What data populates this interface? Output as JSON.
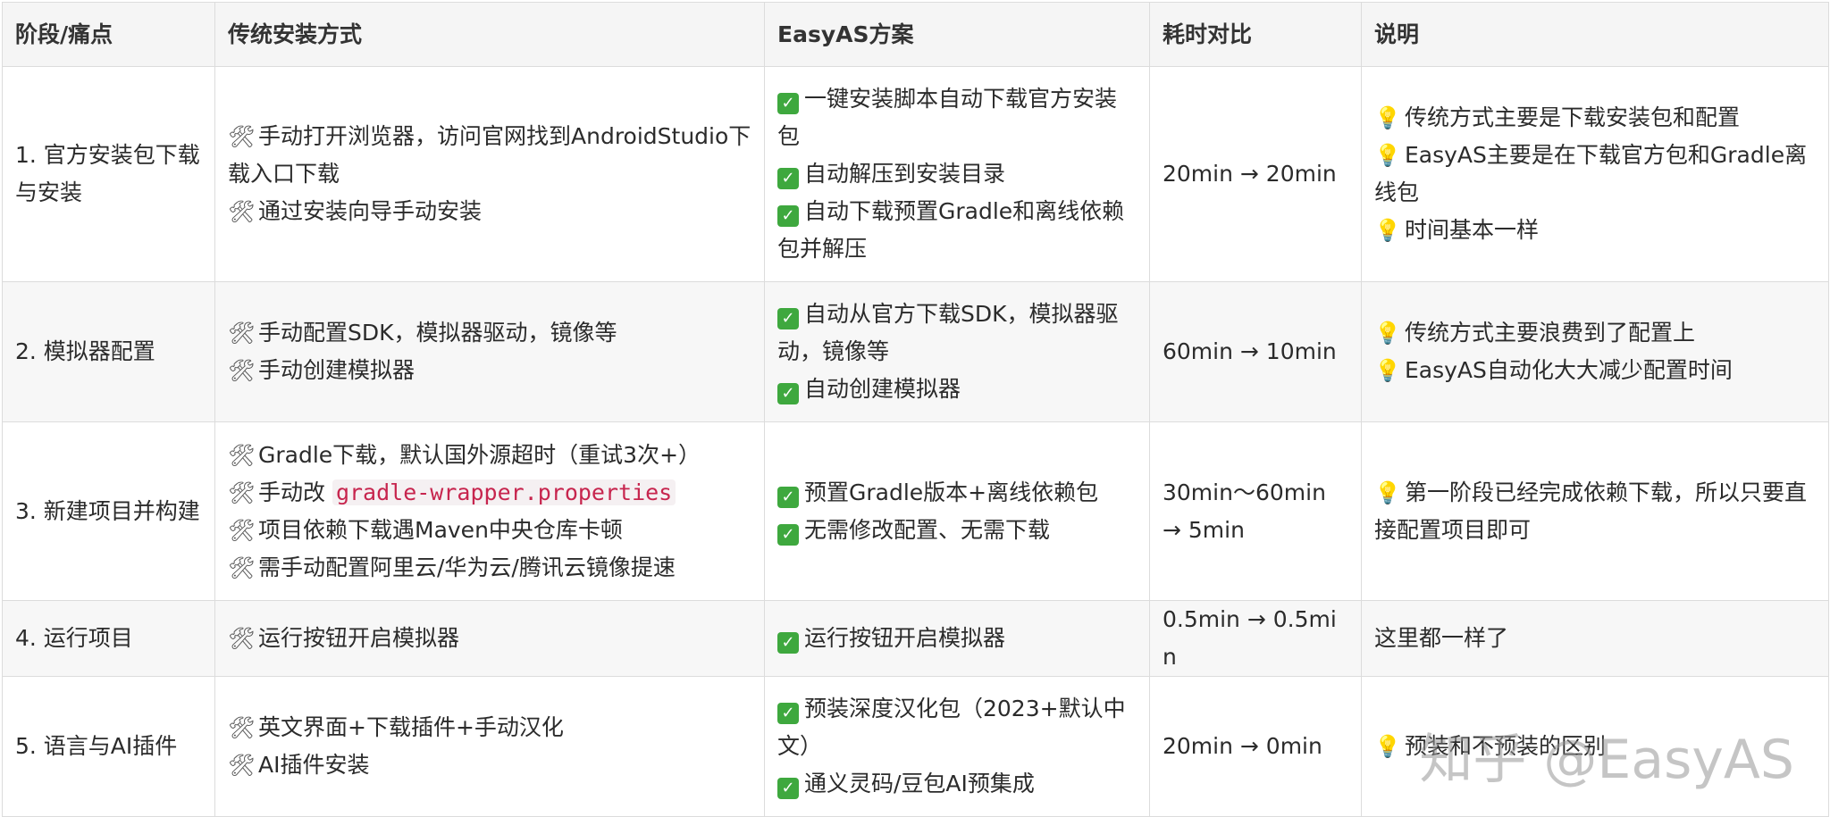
{
  "table": {
    "headers": [
      "阶段/痛点",
      "传统安装方式",
      "EasyAS方案",
      "耗时对比",
      "说明"
    ],
    "rows": [
      {
        "stage": "1. 官方安装包下载与安装",
        "traditional": [
          {
            "text": "手动打开浏览器，访问官网找到AndroidStudio下载入口下载"
          },
          {
            "text": "通过安装向导手动安装"
          }
        ],
        "easyas": [
          {
            "text": "一键安装脚本自动下载官方安装包"
          },
          {
            "text": "自动解压到安装目录"
          },
          {
            "text": "自动下载预置Gradle和离线依赖包并解压"
          }
        ],
        "time": "20min → 20min",
        "notes": [
          {
            "text": "传统方式主要是下载安装包和配置"
          },
          {
            "text": "EasyAS主要是在下载官方包和Gradle离线包"
          },
          {
            "text": "时间基本一样"
          }
        ]
      },
      {
        "stage": "2. 模拟器配置",
        "traditional": [
          {
            "text": "手动配置SDK，模拟器驱动，镜像等"
          },
          {
            "text": "手动创建模拟器"
          }
        ],
        "easyas": [
          {
            "text": "自动从官方下载SDK，模拟器驱动，镜像等"
          },
          {
            "text": "自动创建模拟器"
          }
        ],
        "time": "60min → 10min",
        "notes": [
          {
            "text": "传统方式主要浪费到了配置上"
          },
          {
            "text": "EasyAS自动化大大减少配置时间"
          }
        ]
      },
      {
        "stage": "3. 新建项目并构建",
        "traditional": [
          {
            "text": "Gradle下载，默认国外源超时（重试3次+）"
          },
          {
            "prefix": "手动改 ",
            "code": "gradle-wrapper.properties"
          },
          {
            "text": "项目依赖下载遇Maven中央仓库卡顿"
          },
          {
            "text": "需手动配置阿里云/华为云/腾讯云镜像提速"
          }
        ],
        "easyas": [
          {
            "text": "预置Gradle版本+离线依赖包"
          },
          {
            "text": "无需修改配置、无需下载"
          }
        ],
        "time": "30min～60min → 5min",
        "notes": [
          {
            "text": "第一阶段已经完成依赖下载，所以只要直接配置项目即可"
          }
        ]
      },
      {
        "stage": "4. 运行项目",
        "traditional": [
          {
            "text": "运行按钮开启模拟器"
          }
        ],
        "easyas": [
          {
            "text": "运行按钮开启模拟器"
          }
        ],
        "time": "0.5min → 0.5min",
        "notes_plain": "这里都一样了"
      },
      {
        "stage": "5. 语言与AI插件",
        "traditional": [
          {
            "text": "英文界面+下载插件+手动汉化"
          },
          {
            "text": "AI插件安装"
          }
        ],
        "easyas": [
          {
            "text": "预装深度汉化包（2023+默认中文）"
          },
          {
            "text": "通义灵码/豆包AI预集成"
          }
        ],
        "time": "20min → 0min",
        "notes": [
          {
            "text": "预装和不预装的区别"
          }
        ]
      }
    ]
  },
  "icons": {
    "traditional": "hammer-wrench-icon",
    "easyas": "check-box-icon",
    "notes": "light-bulb-icon"
  },
  "watermark": "知乎 @EasyAS"
}
